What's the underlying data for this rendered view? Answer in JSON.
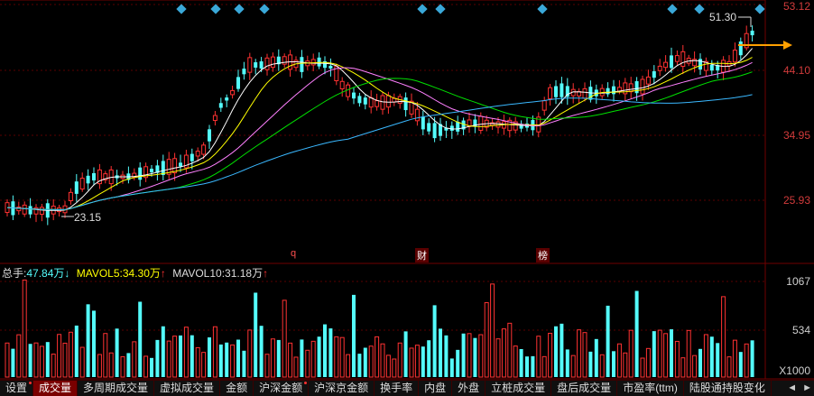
{
  "price_axis": {
    "ticks": [
      "53.12",
      "44.10",
      "34.95",
      "25.93"
    ]
  },
  "price_labels": {
    "high": "51.30",
    "low": "23.15"
  },
  "volume_axis": {
    "ticks": [
      "1067",
      "534"
    ],
    "unit": "X1000"
  },
  "volume_legend": {
    "total_label": "总手:",
    "total_value": "47.84万",
    "total_arrow": "↓",
    "mavol5_label": "MAVOL5:",
    "mavol5_value": "34.30万",
    "mavol5_arrow": "↑",
    "mavol10_label": "MAVOL10:",
    "mavol10_value": "31.18万",
    "mavol10_arrow": "↑"
  },
  "events": [
    "q",
    "财",
    "榜"
  ],
  "tabs": [
    "设置",
    "成交量",
    "多周期成交量",
    "虚拟成交量",
    "金额",
    "沪深金额",
    "沪深京金额",
    "换手率",
    "内盘",
    "外盘",
    "立桩成交量",
    "盘后成交量",
    "市盈率(ttm)",
    "陆股通持股变化"
  ],
  "tab_arrows": [
    "◄",
    "►"
  ],
  "colors": {
    "up": "#ff3232",
    "down": "#54fcfc",
    "ma5": "#ffffff",
    "ma10": "#ffff00",
    "ma20": "#ff80ff",
    "ma30": "#00e000",
    "ma60": "#3ab8ff",
    "arrow": "#ffa000"
  }
}
